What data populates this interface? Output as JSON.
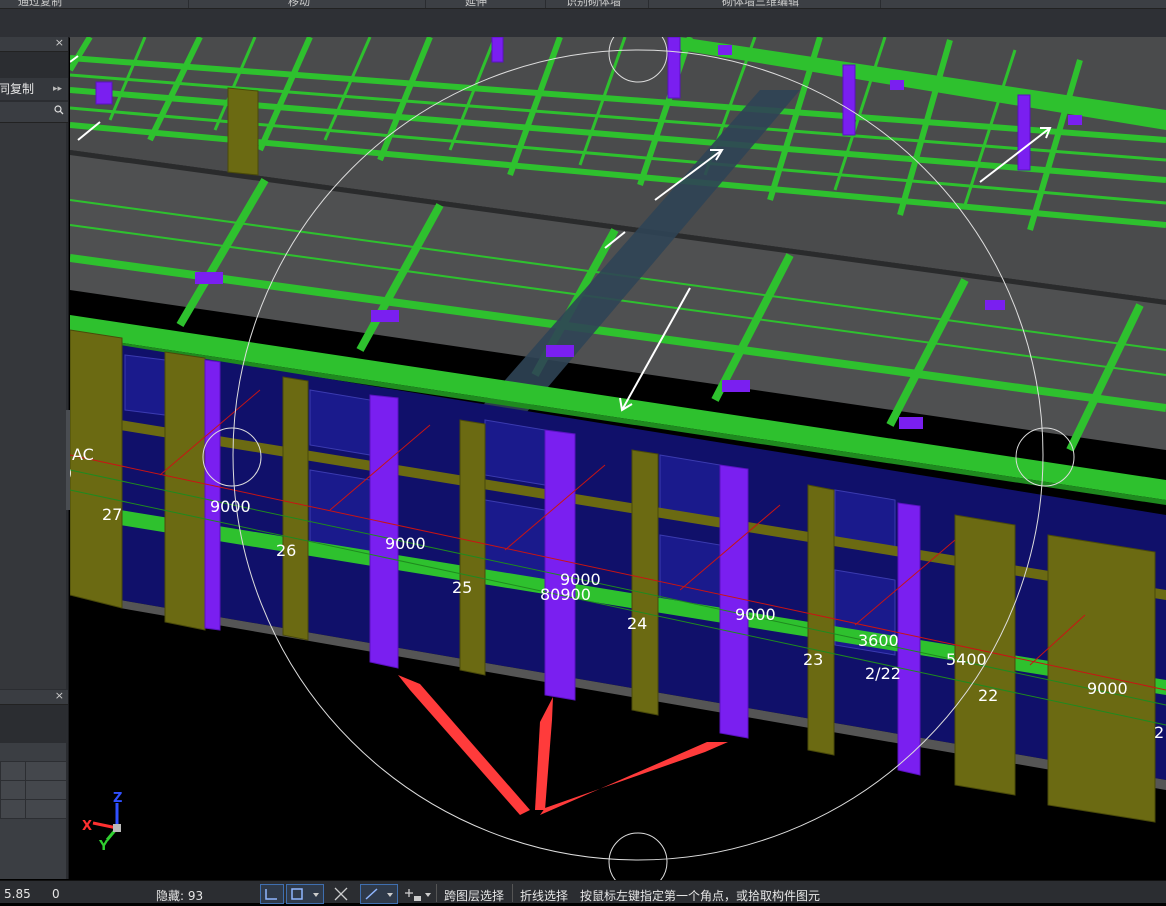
{
  "menu": {
    "items": [
      "通过复制",
      "移动",
      "延伸",
      "识别砌体墙",
      "砌体墙三维编辑"
    ]
  },
  "left_panel": {
    "copy_label": "同复制",
    "expand_glyph": "▸▸",
    "close_glyph": "×"
  },
  "viewport": {
    "axis_labels": [
      "27",
      "26",
      "25",
      "24",
      "23",
      "2/22",
      "22",
      "2"
    ],
    "dimension_labels": [
      "9000",
      "9000",
      "9000",
      "80900",
      "9000",
      "3600",
      "5400",
      "9000"
    ],
    "corner_text": [
      "AC",
      ")"
    ],
    "axes_triad": {
      "x": "X",
      "y": "Y",
      "z": "Z"
    }
  },
  "status": {
    "coord_value": "5.85",
    "z_value": "0",
    "hidden_label": "隐藏: 93",
    "cross_layer_select": "跨图层选择",
    "polyline_select": "折线选择",
    "prompt": "按鼠标左键指定第一个角点，或拾取构件图元"
  },
  "colors": {
    "beam_green": "#2ec12e",
    "column_purple": "#7a1ff0",
    "wall_olive": "#6b6a12",
    "window_navy": "#10106a",
    "slab_gray": "#4a4b4c",
    "annotation_red": "#ff3b3b",
    "axis_line_red": "#c81414",
    "axis_line_green": "#1f8a1f"
  }
}
